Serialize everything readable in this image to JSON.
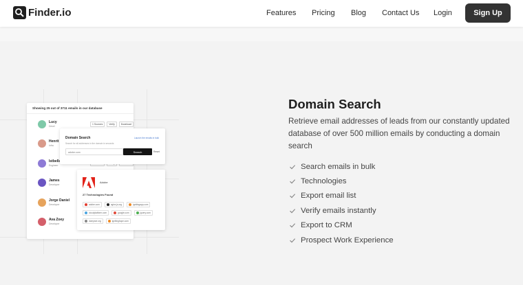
{
  "nav": {
    "logo_text": "Finder.io",
    "links": [
      "Features",
      "Pricing",
      "Blog",
      "Contact Us",
      "Login"
    ],
    "signup_label": "Sign Up"
  },
  "illustration": {
    "list_title": "Showing 25 out of 3711 emails in our database",
    "people": [
      {
        "name": "Lucy",
        "sub": "Devel",
        "chips": [
          "1 Sources",
          "Verify",
          "Download"
        ],
        "avatar_color": "#7ec9a8"
      },
      {
        "name": "Henrit",
        "sub": "Infra",
        "chips": [],
        "avatar_color": "#d99a8a"
      },
      {
        "name": "Istbella",
        "sub": "Engineer",
        "chips": [
          "1 Sources",
          "Verify",
          "Download"
        ],
        "avatar_color": "#8e7bd6"
      },
      {
        "name": "James",
        "sub": "Developer",
        "chips": [],
        "avatar_color": "#6a55c2"
      },
      {
        "name": "Jorge Daniel",
        "sub": "Developer",
        "chips": [],
        "avatar_color": "#e6a35c"
      },
      {
        "name": "Ava Zoey",
        "sub": "Developer",
        "chips": [],
        "avatar_color": "#d45f6a"
      }
    ],
    "search_card": {
      "title": "Domain Search",
      "link": "Launch the emails in bulk",
      "subtitle": "Search for all addresses in the domain in seconds",
      "input_value": "adobe.com",
      "button_label": "Search",
      "reset_label": "Reset"
    },
    "tech_card": {
      "company": "Adobe",
      "count_label": "27 Technologies Found",
      "rows": [
        [
          {
            "label": "adobe.com",
            "color": "#e23b2e"
          },
          {
            "label": "nginx.js.org",
            "color": "#222222"
          },
          {
            "label": "ignitingapp.com",
            "color": "#f08a24"
          }
        ],
        [
          {
            "label": "cloudplatform.com",
            "color": "#4aa4e0"
          },
          {
            "label": "google.com",
            "color": "#e04a3a"
          },
          {
            "label": "jquery.com",
            "color": "#4caf50"
          }
        ],
        [
          {
            "label": "dompser.org",
            "color": "#888888"
          },
          {
            "label": "ignitinghope.com",
            "color": "#f08a24"
          }
        ]
      ]
    }
  },
  "content": {
    "heading": "Domain Search",
    "description": "Retrieve email addresses of leads from our constantly updated database of over 500 million emails by conducting a domain search",
    "features": [
      "Search emails in bulk",
      "Technologies",
      "Export email list",
      "Verify emails instantly",
      "Export to CRM",
      "Prospect Work Experience"
    ]
  },
  "colors": {
    "primary_dark": "#333333",
    "accent": "#1e1e1e",
    "check": "#8a8a8a"
  }
}
